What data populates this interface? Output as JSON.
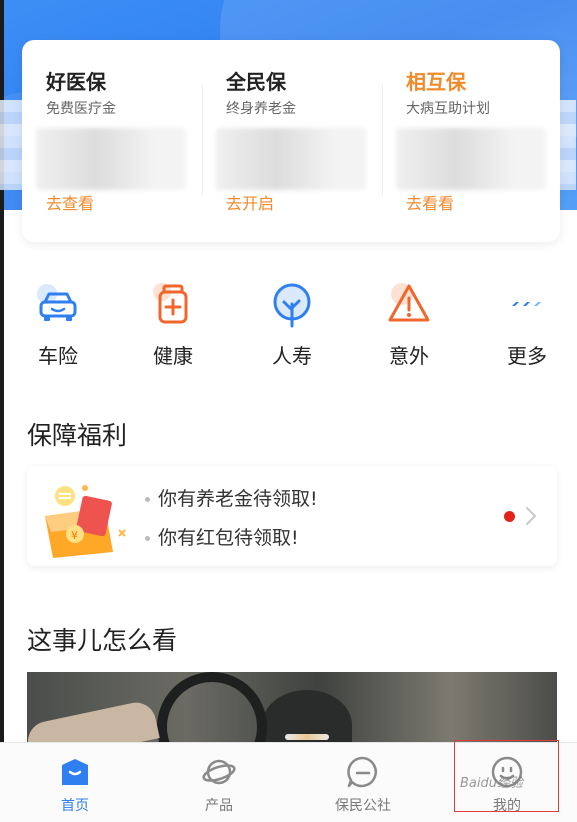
{
  "insurance": [
    {
      "name": "好医保",
      "desc": "免费医疗金",
      "link": "去查看",
      "name_color": "#222222"
    },
    {
      "name": "全民保",
      "desc": "终身养老金",
      "link": "去开启",
      "name_color": "#222222"
    },
    {
      "name": "相互保",
      "desc": "大病互助计划",
      "link": "去看看",
      "name_color": "#f08a2b"
    }
  ],
  "categories": [
    {
      "label": "车险",
      "icon": "car-icon"
    },
    {
      "label": "健康",
      "icon": "medicine-bottle-icon"
    },
    {
      "label": "人寿",
      "icon": "tree-icon"
    },
    {
      "label": "意外",
      "icon": "warning-icon"
    },
    {
      "label": "更多",
      "icon": "more-icon"
    }
  ],
  "benefits": {
    "title": "保障福利",
    "lines": [
      "你有养老金待领取!",
      "你有红包待领取!"
    ]
  },
  "news": {
    "title": "这事儿怎么看"
  },
  "tabbar": [
    {
      "label": "首页",
      "icon": "home-bag-icon",
      "active": true
    },
    {
      "label": "产品",
      "icon": "planet-icon",
      "active": false
    },
    {
      "label": "保民公社",
      "icon": "chat-bubble-icon",
      "active": false
    },
    {
      "label": "我的",
      "icon": "smile-face-icon",
      "active": false
    }
  ],
  "watermark": "Baidu经验",
  "colors": {
    "brand_blue": "#2f7ff0",
    "accent_orange": "#f08a2b",
    "alert_red": "#e2231a"
  }
}
